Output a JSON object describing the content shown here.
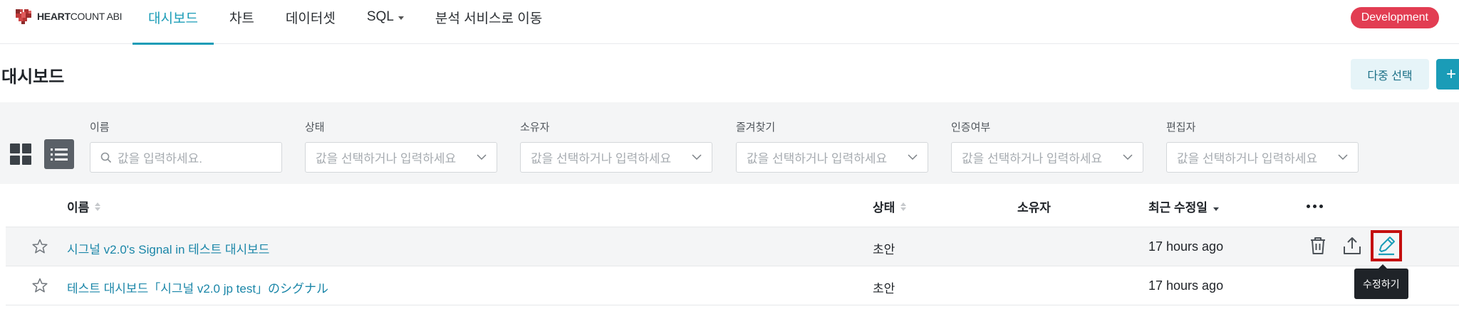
{
  "app": {
    "logo_bold": "HEART",
    "logo_rest": "COUNT ABI",
    "env_badge": "Development"
  },
  "nav": {
    "tabs": [
      {
        "label": "대시보드",
        "active": true
      },
      {
        "label": "차트"
      },
      {
        "label": "데이터셋"
      },
      {
        "label": "SQL",
        "has_caret": true
      },
      {
        "label": "분석 서비스로 이동"
      }
    ]
  },
  "page": {
    "title": "대시보드",
    "multi_select_label": "다중 선택",
    "create_label": "+"
  },
  "filters": [
    {
      "label": "이름",
      "placeholder": "값을 입력하세요.",
      "type": "search"
    },
    {
      "label": "상태",
      "placeholder": "값을 선택하거나 입력하세요",
      "type": "select"
    },
    {
      "label": "소유자",
      "placeholder": "값을 선택하거나 입력하세요",
      "type": "select"
    },
    {
      "label": "즐겨찾기",
      "placeholder": "값을 선택하거나 입력하세요",
      "type": "select"
    },
    {
      "label": "인증여부",
      "placeholder": "값을 선택하거나 입력하세요",
      "type": "select"
    },
    {
      "label": "편집자",
      "placeholder": "값을 선택하거나 입력하세요",
      "type": "select"
    }
  ],
  "table": {
    "columns": {
      "name": "이름",
      "status": "상태",
      "owner": "소유자",
      "updated": "최근 수정일"
    },
    "rows": [
      {
        "name": "시그널 v2.0's Signal in 테스트 대시보드",
        "status": "초안",
        "owner": "",
        "updated": "17 hours ago"
      },
      {
        "name": "테스트 대시보드「시그널 v2.0 jp test」のシグナル",
        "status": "초안",
        "owner": "",
        "updated": "17 hours ago"
      }
    ]
  },
  "tooltip": "수정하기",
  "colors": {
    "accent": "#1a9cb7",
    "badge": "#e23d52",
    "highlight": "#c40f0f"
  }
}
